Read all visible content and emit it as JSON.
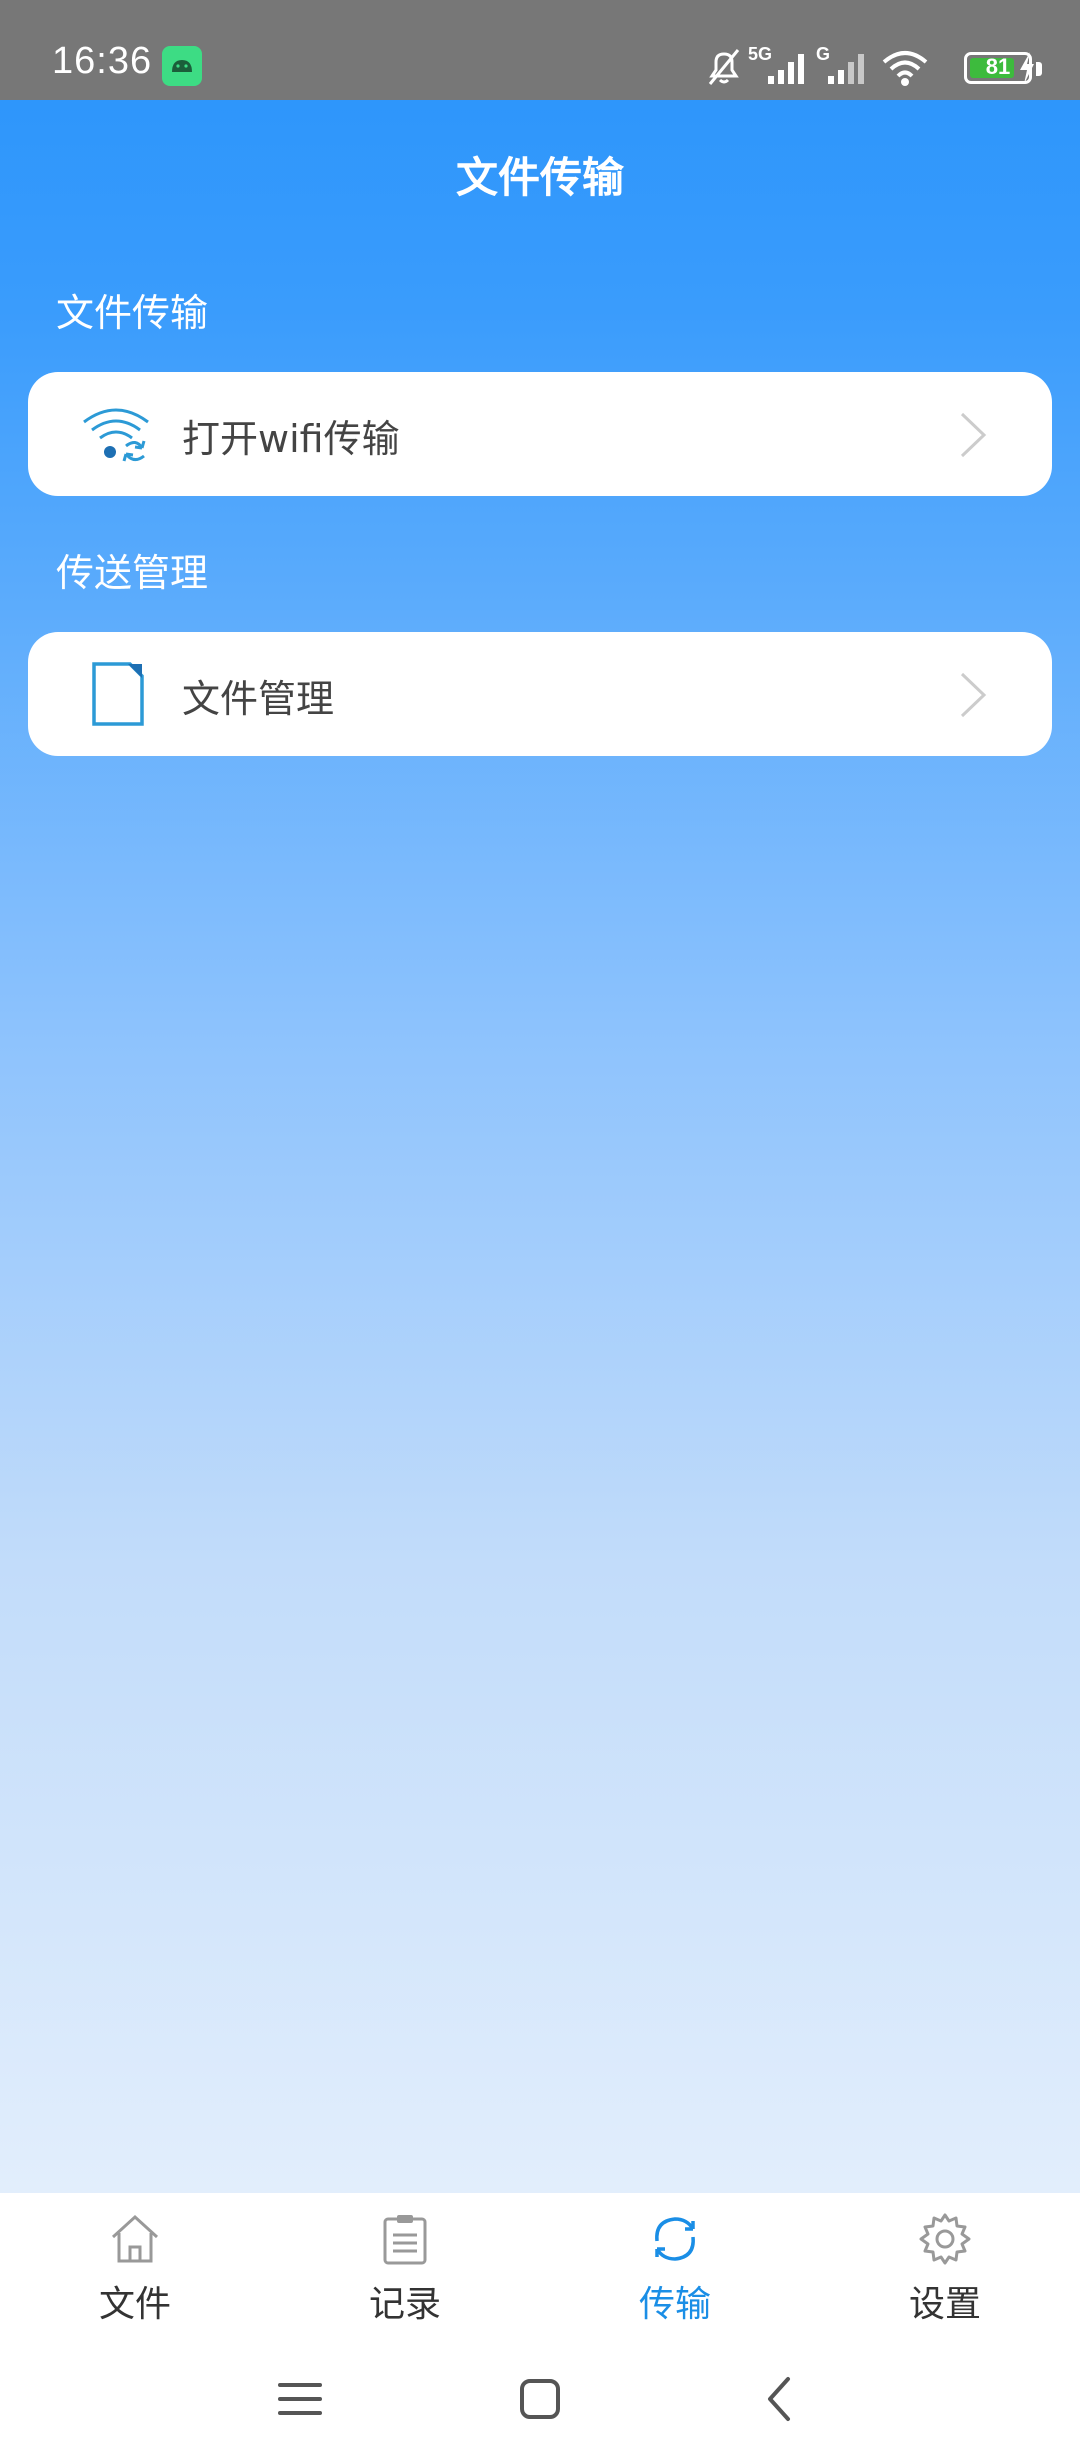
{
  "status_bar": {
    "time": "16:36",
    "network_1": "5G",
    "network_2": "G",
    "battery": "81",
    "battery_level": 0.81
  },
  "header": {
    "title": "文件传输"
  },
  "sections": [
    {
      "label": "文件传输",
      "item": {
        "label": "打开wifi传输",
        "icon": "wifi-transfer-icon"
      }
    },
    {
      "label": "传送管理",
      "item": {
        "label": "文件管理",
        "icon": "file-icon"
      }
    }
  ],
  "tabs": [
    {
      "label": "文件",
      "icon": "home-icon",
      "active": false
    },
    {
      "label": "记录",
      "icon": "clipboard-icon",
      "active": false
    },
    {
      "label": "传输",
      "icon": "sync-icon",
      "active": true
    },
    {
      "label": "设置",
      "icon": "gear-icon",
      "active": false
    }
  ],
  "colors": {
    "accent": "#1a8ee6",
    "header_blue": "#2e96fb",
    "status_bar": "#777777"
  }
}
